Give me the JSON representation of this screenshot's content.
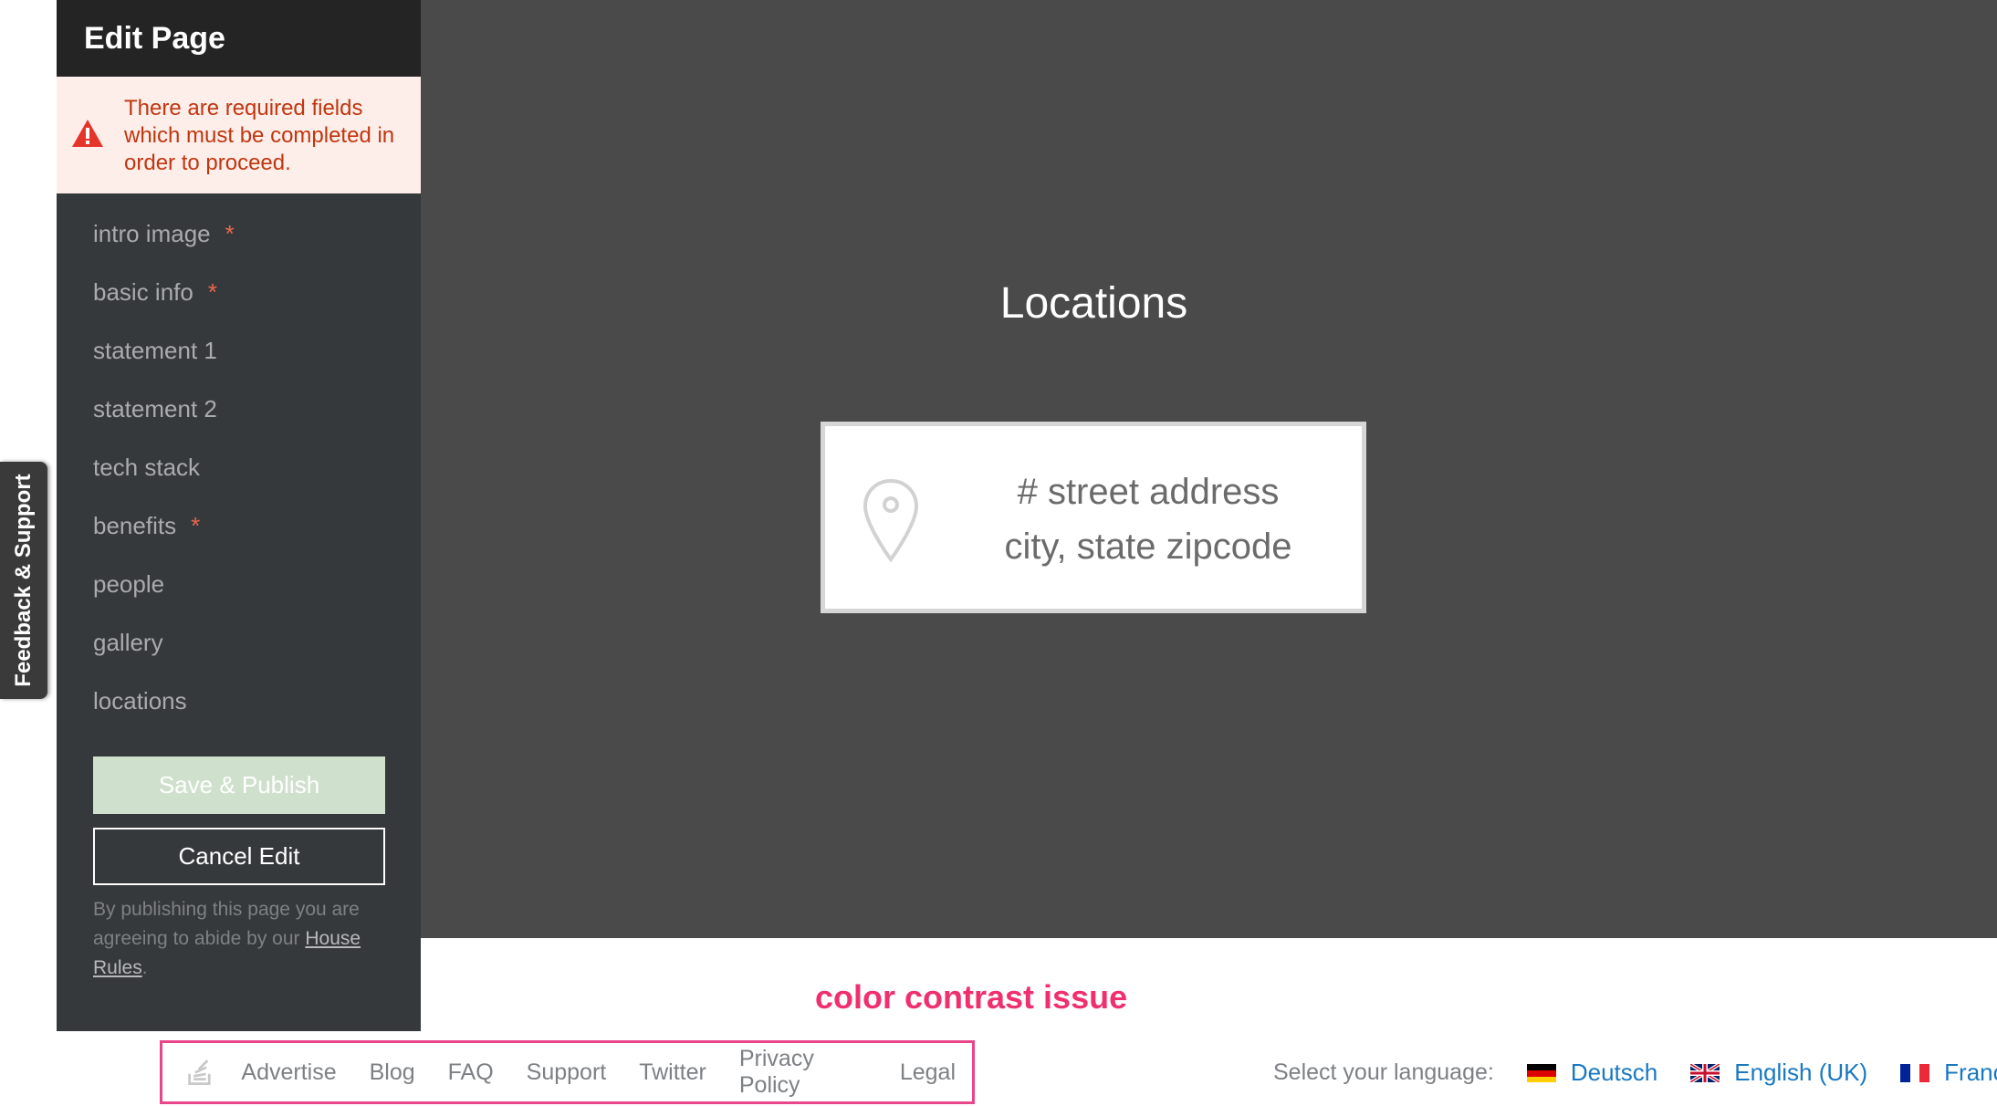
{
  "sidebar": {
    "title": "Edit Page",
    "alert": "There are required fields which must be completed in order to proceed.",
    "items": [
      {
        "label": "intro image",
        "required": "*"
      },
      {
        "label": "basic info",
        "required": "*"
      },
      {
        "label": "statement 1"
      },
      {
        "label": "statement 2"
      },
      {
        "label": "tech stack"
      },
      {
        "label": "benefits",
        "required": "*"
      },
      {
        "label": "people"
      },
      {
        "label": "gallery"
      },
      {
        "label": "locations"
      }
    ],
    "save_label": "Save & Publish",
    "cancel_label": "Cancel Edit",
    "legal_text": "By publishing this page you are agreeing to abide by our",
    "legal_link": "House Rules",
    "legal_end": "."
  },
  "feedback_tab": "Feedback & Support",
  "main": {
    "section_title": "Locations",
    "address_line1": "# street address",
    "address_line2": "city, state zipcode"
  },
  "annotation": "color contrast issue",
  "footer": {
    "links": [
      "Advertise",
      "Blog",
      "FAQ",
      "Support",
      "Twitter",
      "Privacy Policy",
      "Legal"
    ],
    "language_label": "Select your language:",
    "languages": [
      "Deutsch",
      "English (UK)",
      "Françai"
    ]
  },
  "colors": {
    "sidebar_bg": "#36393b",
    "main_bg": "#4a4a4b",
    "alert_bg": "#fdeeea",
    "alert_text": "#c0360f",
    "save_button_bg": "#cfe1cc",
    "annotation": "#f0306e",
    "link_blue": "#1a78c2"
  }
}
